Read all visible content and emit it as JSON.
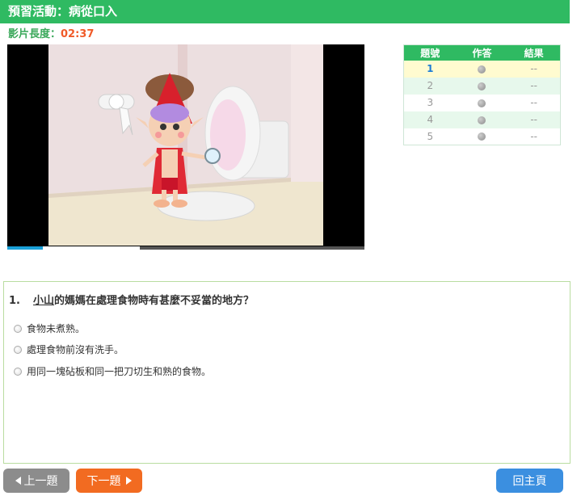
{
  "header": {
    "title": "預習活動：病從口入"
  },
  "video": {
    "duration_label": "影片長度：",
    "duration_value": "02:37",
    "progress": 0.1,
    "buffered_from": 0.37
  },
  "answer_table": {
    "headers": [
      "題號",
      "作答",
      "結果"
    ],
    "rows": [
      {
        "num": "1",
        "result": "--"
      },
      {
        "num": "2",
        "result": "--"
      },
      {
        "num": "3",
        "result": "--"
      },
      {
        "num": "4",
        "result": "--"
      },
      {
        "num": "5",
        "result": "--"
      }
    ],
    "current_index": 0
  },
  "question": {
    "number": "1.",
    "name": "小山",
    "text": "的媽媽在處理食物時有甚麼不妥當的地方？",
    "options": [
      "食物未煮熟。",
      "處理食物前沒有洗手。",
      "用同一塊砧板和同一把刀切生和熟的食物。"
    ]
  },
  "buttons": {
    "prev": "上一題",
    "next": "下一題",
    "home": "回主頁"
  },
  "colors": {
    "header_green": "#2fba62",
    "accent_orange": "#f26b21",
    "home_blue": "#3b8fe0"
  }
}
